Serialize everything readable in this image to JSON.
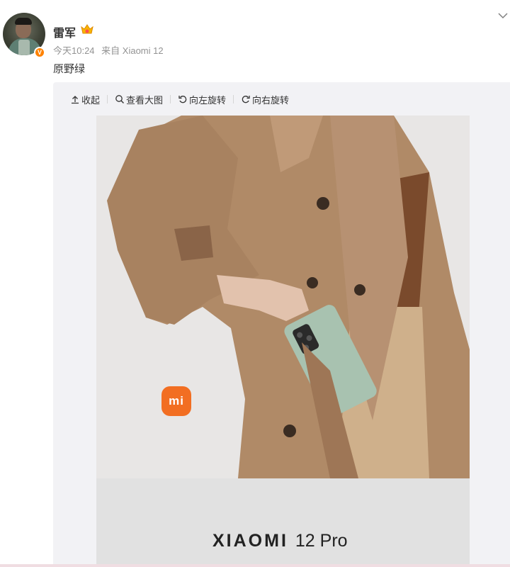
{
  "post": {
    "username": "雷军",
    "time": "今天10:24",
    "source": "来自 Xiaomi 12",
    "text": "原野绿",
    "verified_mark": "V"
  },
  "toolbar": {
    "collapse": "收起",
    "view_large": "查看大图",
    "rotate_left": "向左旋转",
    "rotate_right": "向右旋转"
  },
  "image": {
    "logo_text": "mi",
    "brand_name": "XIAOMI",
    "brand_model": "12 Pro"
  },
  "colors": {
    "accent": "#ff8200",
    "mi_logo": "#f26e22",
    "coat": "#b08a67",
    "phone": "#a8c2b0"
  }
}
